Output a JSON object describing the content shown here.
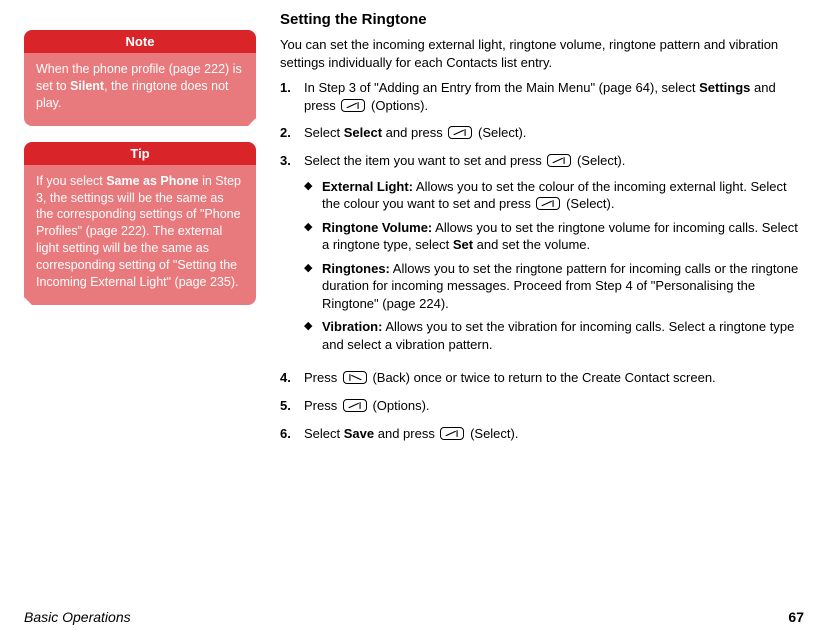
{
  "sidebar": {
    "note": {
      "header": "Note",
      "pre": "When the phone profile (page 222) is set to ",
      "bold": "Silent",
      "post": ", the ringtone does not play."
    },
    "tip": {
      "header": "Tip",
      "pre": "If you select ",
      "bold": "Same as Phone",
      "post": " in Step 3, the settings will be the same as the corresponding settings of \"Phone Profiles\" (page 222). The external light setting will be the same as corresponding setting of \"Setting the Incoming External Light\" (page 235)."
    }
  },
  "main": {
    "title": "Setting the Ringtone",
    "intro": "You can set the incoming external light, ringtone volume, ringtone pattern and vibration settings individually for each Contacts list entry.",
    "steps": [
      {
        "n": "1.",
        "t1": "In Step 3 of \"Adding an Entry from the Main Menu\" (page 64), select ",
        "b1": "Settings",
        "t2": " and press ",
        "key": "left",
        "t3": " (Options)."
      },
      {
        "n": "2.",
        "t1": "Select ",
        "b1": "Select",
        "t2": " and press ",
        "key": "left",
        "t3": " (Select)."
      },
      {
        "n": "3.",
        "t1": "Select the item you want to set and press ",
        "key": "left",
        "t3": " (Select).",
        "sub": [
          {
            "b": "External Light:",
            "t": " Allows you to set the colour of the incoming external light. Select the colour you want to set and press ",
            "key": "left",
            "t2": " (Select)."
          },
          {
            "b": "Ringtone Volume:",
            "t": " Allows you to set the ringtone volume for incoming calls. Select a ringtone type, select ",
            "b2": "Set",
            "t2": " and set the volume."
          },
          {
            "b": "Ringtones:",
            "t": " Allows you to set the ringtone pattern for incoming calls or the ringtone duration for incoming messages. Proceed from Step 4 of \"Personalising the Ringtone\" (page 224)."
          },
          {
            "b": "Vibration:",
            "t": " Allows you to set the vibration for incoming calls. Select a ringtone type and select a vibration pattern."
          }
        ]
      },
      {
        "n": "4.",
        "t1": "Press ",
        "key": "right",
        "t3": " (Back) once or twice to return to the Create Contact screen."
      },
      {
        "n": "5.",
        "t1": "Press ",
        "key": "left",
        "t3": " (Options)."
      },
      {
        "n": "6.",
        "t1": "Select ",
        "b1": "Save",
        "t2": " and press ",
        "key": "left",
        "t3": " (Select)."
      }
    ]
  },
  "footer": {
    "section": "Basic Operations",
    "page": "67"
  },
  "icons": {
    "diamond": "◆"
  }
}
